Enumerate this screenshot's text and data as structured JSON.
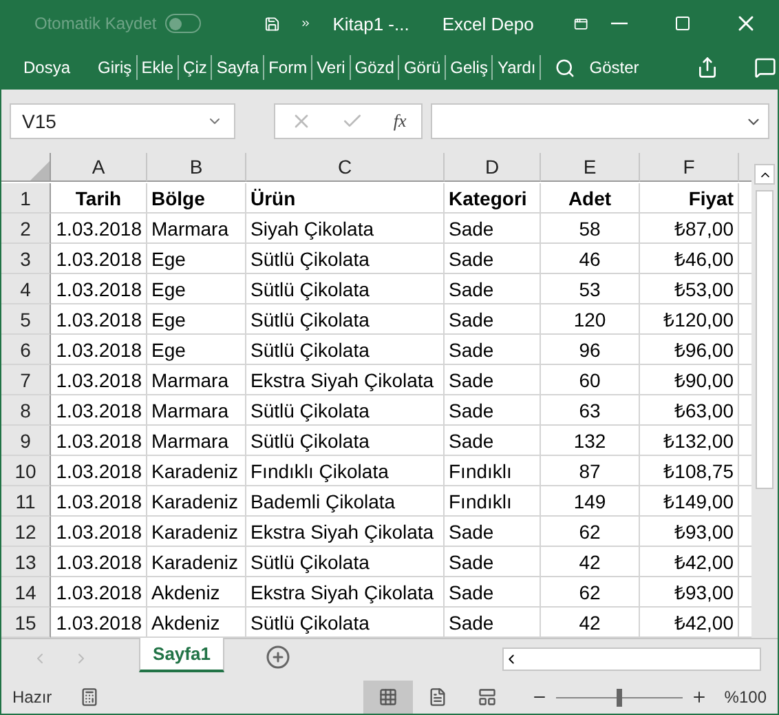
{
  "title_bar": {
    "autosave": {
      "label": "Otomatik Kaydet",
      "on": false
    },
    "file_name": "Kitap1  -...",
    "user": "Excel Depo"
  },
  "ribbon_tabs": [
    {
      "label": "Dosya",
      "selected": false
    },
    {
      "label": "Giriş",
      "selected": false
    },
    {
      "label": "Ekle",
      "selected": false
    },
    {
      "label": "Çiz",
      "selected": false
    },
    {
      "label": "Sayfa",
      "selected": false
    },
    {
      "label": "Form",
      "selected": false
    },
    {
      "label": "Veri",
      "selected": false
    },
    {
      "label": "Gözd",
      "selected": false
    },
    {
      "label": "Görü",
      "selected": false
    },
    {
      "label": "Geliş",
      "selected": false
    },
    {
      "label": "Yardı",
      "selected": false
    }
  ],
  "search": {
    "label": "Göster"
  },
  "formula_bar": {
    "name_box": "V15",
    "function_symbol": "fx"
  },
  "columns": [
    {
      "letter": "A",
      "kind": "date"
    },
    {
      "letter": "B",
      "kind": "text"
    },
    {
      "letter": "C",
      "kind": "text"
    },
    {
      "letter": "D",
      "kind": "text"
    },
    {
      "letter": "E",
      "kind": "number"
    },
    {
      "letter": "F",
      "kind": "currency"
    }
  ],
  "rows": [
    {
      "number": "1",
      "kind": "header",
      "cells": [
        "Tarih",
        "Bölge",
        "Ürün",
        "Kategori",
        "Adet",
        "Fiyat"
      ]
    },
    {
      "number": "2",
      "kind": "data",
      "cells": [
        "1.03.2018",
        "Marmara",
        "Siyah Çikolata",
        "Sade",
        "58",
        "₺87,00"
      ]
    },
    {
      "number": "3",
      "kind": "data",
      "cells": [
        "1.03.2018",
        "Ege",
        "Sütlü Çikolata",
        "Sade",
        "46",
        "₺46,00"
      ]
    },
    {
      "number": "4",
      "kind": "data",
      "cells": [
        "1.03.2018",
        "Ege",
        "Sütlü Çikolata",
        "Sade",
        "53",
        "₺53,00"
      ]
    },
    {
      "number": "5",
      "kind": "data",
      "cells": [
        "1.03.2018",
        "Ege",
        "Sütlü Çikolata",
        "Sade",
        "120",
        "₺120,00"
      ]
    },
    {
      "number": "6",
      "kind": "data",
      "cells": [
        "1.03.2018",
        "Ege",
        "Sütlü Çikolata",
        "Sade",
        "96",
        "₺96,00"
      ]
    },
    {
      "number": "7",
      "kind": "data",
      "cells": [
        "1.03.2018",
        "Marmara",
        "Ekstra Siyah Çikolata",
        "Sade",
        "60",
        "₺90,00"
      ]
    },
    {
      "number": "8",
      "kind": "data",
      "cells": [
        "1.03.2018",
        "Marmara",
        "Sütlü Çikolata",
        "Sade",
        "63",
        "₺63,00"
      ]
    },
    {
      "number": "9",
      "kind": "data",
      "cells": [
        "1.03.2018",
        "Marmara",
        "Sütlü Çikolata",
        "Sade",
        "132",
        "₺132,00"
      ]
    },
    {
      "number": "10",
      "kind": "data",
      "cells": [
        "1.03.2018",
        "Karadeniz",
        "Fındıklı Çikolata",
        "Fındıklı",
        "87",
        "₺108,75"
      ]
    },
    {
      "number": "11",
      "kind": "data",
      "cells": [
        "1.03.2018",
        "Karadeniz",
        "Bademli Çikolata",
        "Fındıklı",
        "149",
        "₺149,00"
      ]
    },
    {
      "number": "12",
      "kind": "data",
      "cells": [
        "1.03.2018",
        "Karadeniz",
        "Ekstra Siyah Çikolata",
        "Sade",
        "62",
        "₺93,00"
      ]
    },
    {
      "number": "13",
      "kind": "data",
      "cells": [
        "1.03.2018",
        "Karadeniz",
        "Sütlü Çikolata",
        "Sade",
        "42",
        "₺42,00"
      ]
    },
    {
      "number": "14",
      "kind": "data",
      "cells": [
        "1.03.2018",
        "Akdeniz",
        "Ekstra Siyah Çikolata",
        "Sade",
        "62",
        "₺93,00"
      ]
    },
    {
      "number": "15",
      "kind": "data",
      "cells": [
        "1.03.2018",
        "Akdeniz",
        "Sütlü Çikolata",
        "Sade",
        "42",
        "₺42,00"
      ]
    }
  ],
  "sheet_tabs": [
    {
      "label": "Sayfa1",
      "selected": true
    }
  ],
  "status_bar": {
    "status": "Hazır",
    "views": [
      {
        "kind": "normal",
        "selected": true
      },
      {
        "kind": "page_layout",
        "selected": false
      },
      {
        "kind": "page_break",
        "selected": false
      }
    ],
    "zoom_slider": {
      "level": 0.5
    },
    "zoom": "%100"
  }
}
